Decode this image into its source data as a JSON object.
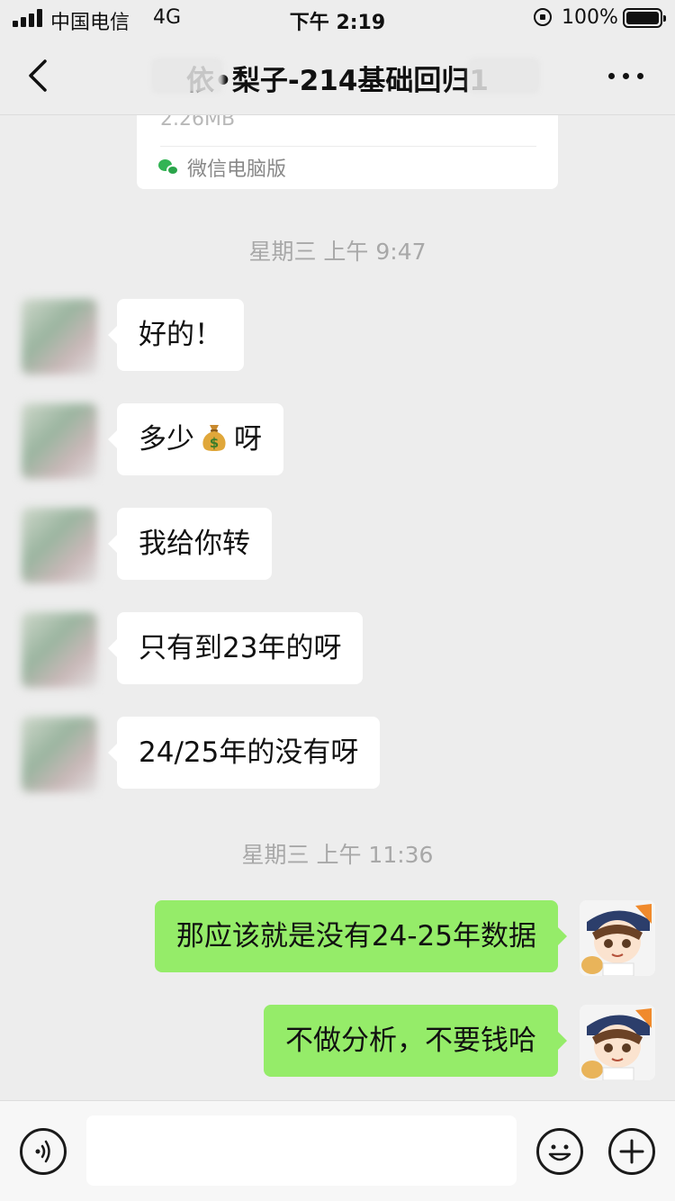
{
  "status_bar": {
    "carrier": "中国电信",
    "network": "4G",
    "time": "下午 2:19",
    "battery": "100%"
  },
  "nav": {
    "title": "依•梨子-214基础回归1",
    "more_icon": "more-dots-icon",
    "back_icon": "chevron-left-icon"
  },
  "file_card": {
    "size": "2.26MB",
    "source": "微信电脑版"
  },
  "timestamps": [
    "星期三 上午 9:47",
    "星期三 上午 11:36"
  ],
  "messages": [
    {
      "side": "left",
      "text": "好的！"
    },
    {
      "side": "left",
      "text_before": "多少",
      "emoji": "moneybag-icon",
      "text_after": "呀"
    },
    {
      "side": "left",
      "text": "我给你转"
    },
    {
      "side": "left",
      "text": "只有到23年的呀"
    },
    {
      "side": "left",
      "text": "24/25年的没有呀"
    },
    {
      "side": "right",
      "text": "那应该就是没有24-25年数据"
    },
    {
      "side": "right",
      "text": "不做分析，不要钱哈"
    }
  ],
  "input_bar": {
    "voice_icon": "voice-icon",
    "emoji_icon": "emoji-icon",
    "plus_icon": "plus-icon",
    "placeholder": ""
  },
  "colors": {
    "background": "#ededed",
    "bubble_self": "#95ec69",
    "bubble_other": "#ffffff",
    "timestamp": "#a8a8a8"
  }
}
